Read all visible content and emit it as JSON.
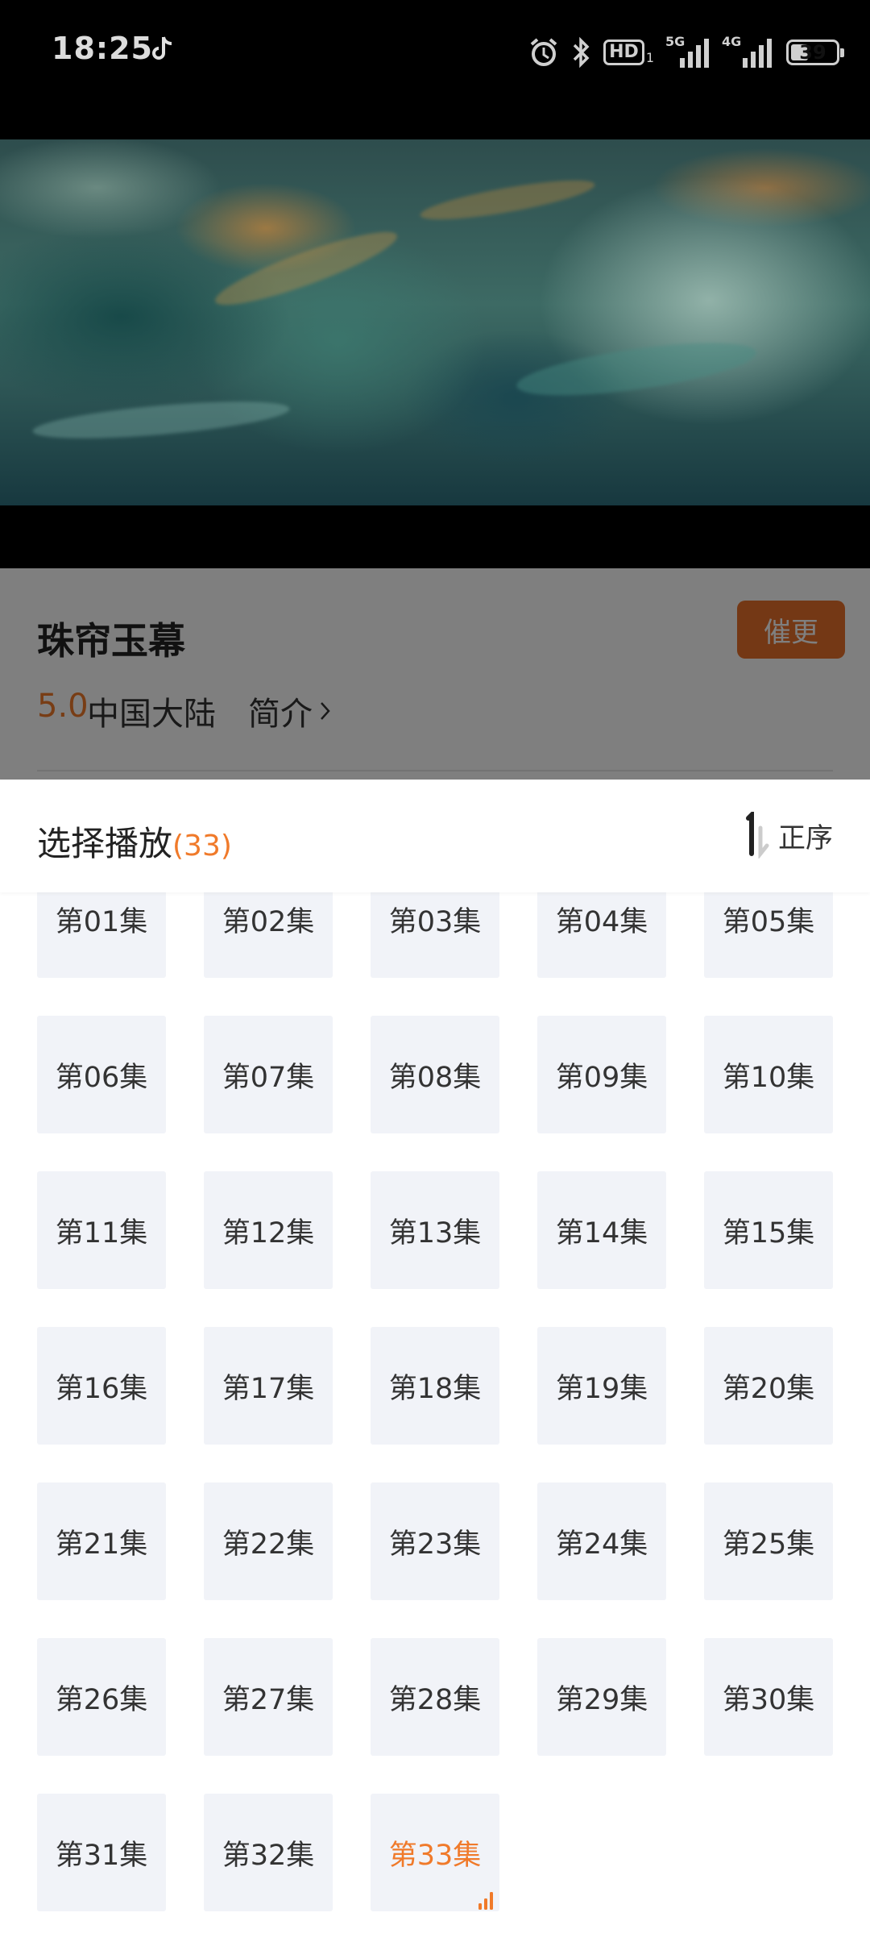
{
  "status_bar": {
    "time": "18:25",
    "signal_5g_label": "5G",
    "signal_4g_label": "4G",
    "hd_label": "HD",
    "hd_sub": "1",
    "battery_level": "39",
    "battery_fraction": 0.39,
    "icons": [
      "tiktok-icon",
      "alarm-icon",
      "bluetooth-icon",
      "hd-icon",
      "signal-5g-icon",
      "signal-4g-icon",
      "battery-icon"
    ]
  },
  "show": {
    "title": "珠帘玉幕",
    "rating": "5.0",
    "region": "中国大陆",
    "intro_label": "简介",
    "urge_update_label": "催更"
  },
  "episode_panel": {
    "title": "选择播放",
    "count": "(33)",
    "sort_label": "正序",
    "current_episode_index": 32,
    "episodes": [
      {
        "label": "第01集"
      },
      {
        "label": "第02集"
      },
      {
        "label": "第03集"
      },
      {
        "label": "第04集"
      },
      {
        "label": "第05集"
      },
      {
        "label": "第06集"
      },
      {
        "label": "第07集"
      },
      {
        "label": "第08集"
      },
      {
        "label": "第09集"
      },
      {
        "label": "第10集"
      },
      {
        "label": "第11集"
      },
      {
        "label": "第12集"
      },
      {
        "label": "第13集"
      },
      {
        "label": "第14集"
      },
      {
        "label": "第15集"
      },
      {
        "label": "第16集"
      },
      {
        "label": "第17集"
      },
      {
        "label": "第18集"
      },
      {
        "label": "第19集"
      },
      {
        "label": "第20集"
      },
      {
        "label": "第21集"
      },
      {
        "label": "第22集"
      },
      {
        "label": "第23集"
      },
      {
        "label": "第24集"
      },
      {
        "label": "第25集"
      },
      {
        "label": "第26集"
      },
      {
        "label": "第27集"
      },
      {
        "label": "第28集"
      },
      {
        "label": "第29集"
      },
      {
        "label": "第30集"
      },
      {
        "label": "第31集"
      },
      {
        "label": "第32集"
      },
      {
        "label": "第33集"
      }
    ]
  },
  "colors": {
    "accent": "#f07a2a",
    "urge_button": "#e8702a",
    "episode_tile": "#f1f3f8",
    "text_primary": "#222222"
  }
}
